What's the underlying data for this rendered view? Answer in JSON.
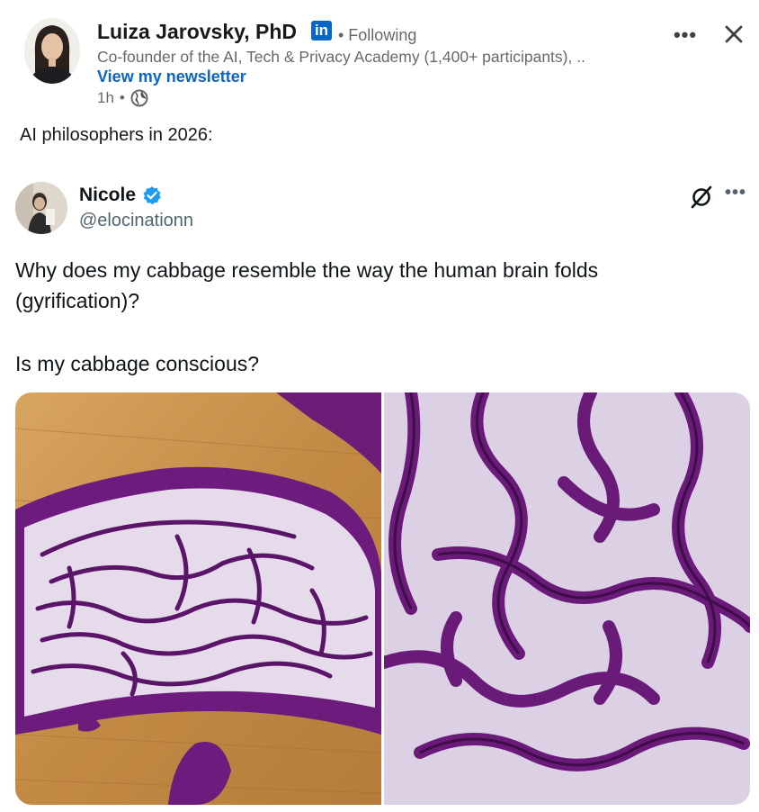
{
  "post": {
    "author_name": "Luiza Jarovsky, PhD",
    "linkedin_badge": "in",
    "follow_status": "• Following",
    "subtitle": "Co-founder of the AI, Tech & Privacy Academy (1,400+ participants), ..",
    "newsletter_link": "View my newsletter",
    "time": "1h",
    "time_sep": "•",
    "more_label": "•••",
    "text": "AI philosophers in 2026:"
  },
  "tweet": {
    "name": "Nicole",
    "handle": "@elocinationn",
    "more_label": "•••",
    "line1": "Why does my cabbage resemble the  way the human brain folds",
    "line2": "(gyrification)?",
    "line3": "Is my cabbage conscious?"
  },
  "colors": {
    "linkedin_blue": "#0a66c2",
    "verified_blue": "#1d9bf0",
    "cabbage_purple": "#7a1f86",
    "cutting_board": "#c9944a"
  },
  "icons": [
    "linkedin-icon",
    "globe-icon",
    "more-icon",
    "close-icon",
    "verified-icon",
    "grok-icon"
  ]
}
